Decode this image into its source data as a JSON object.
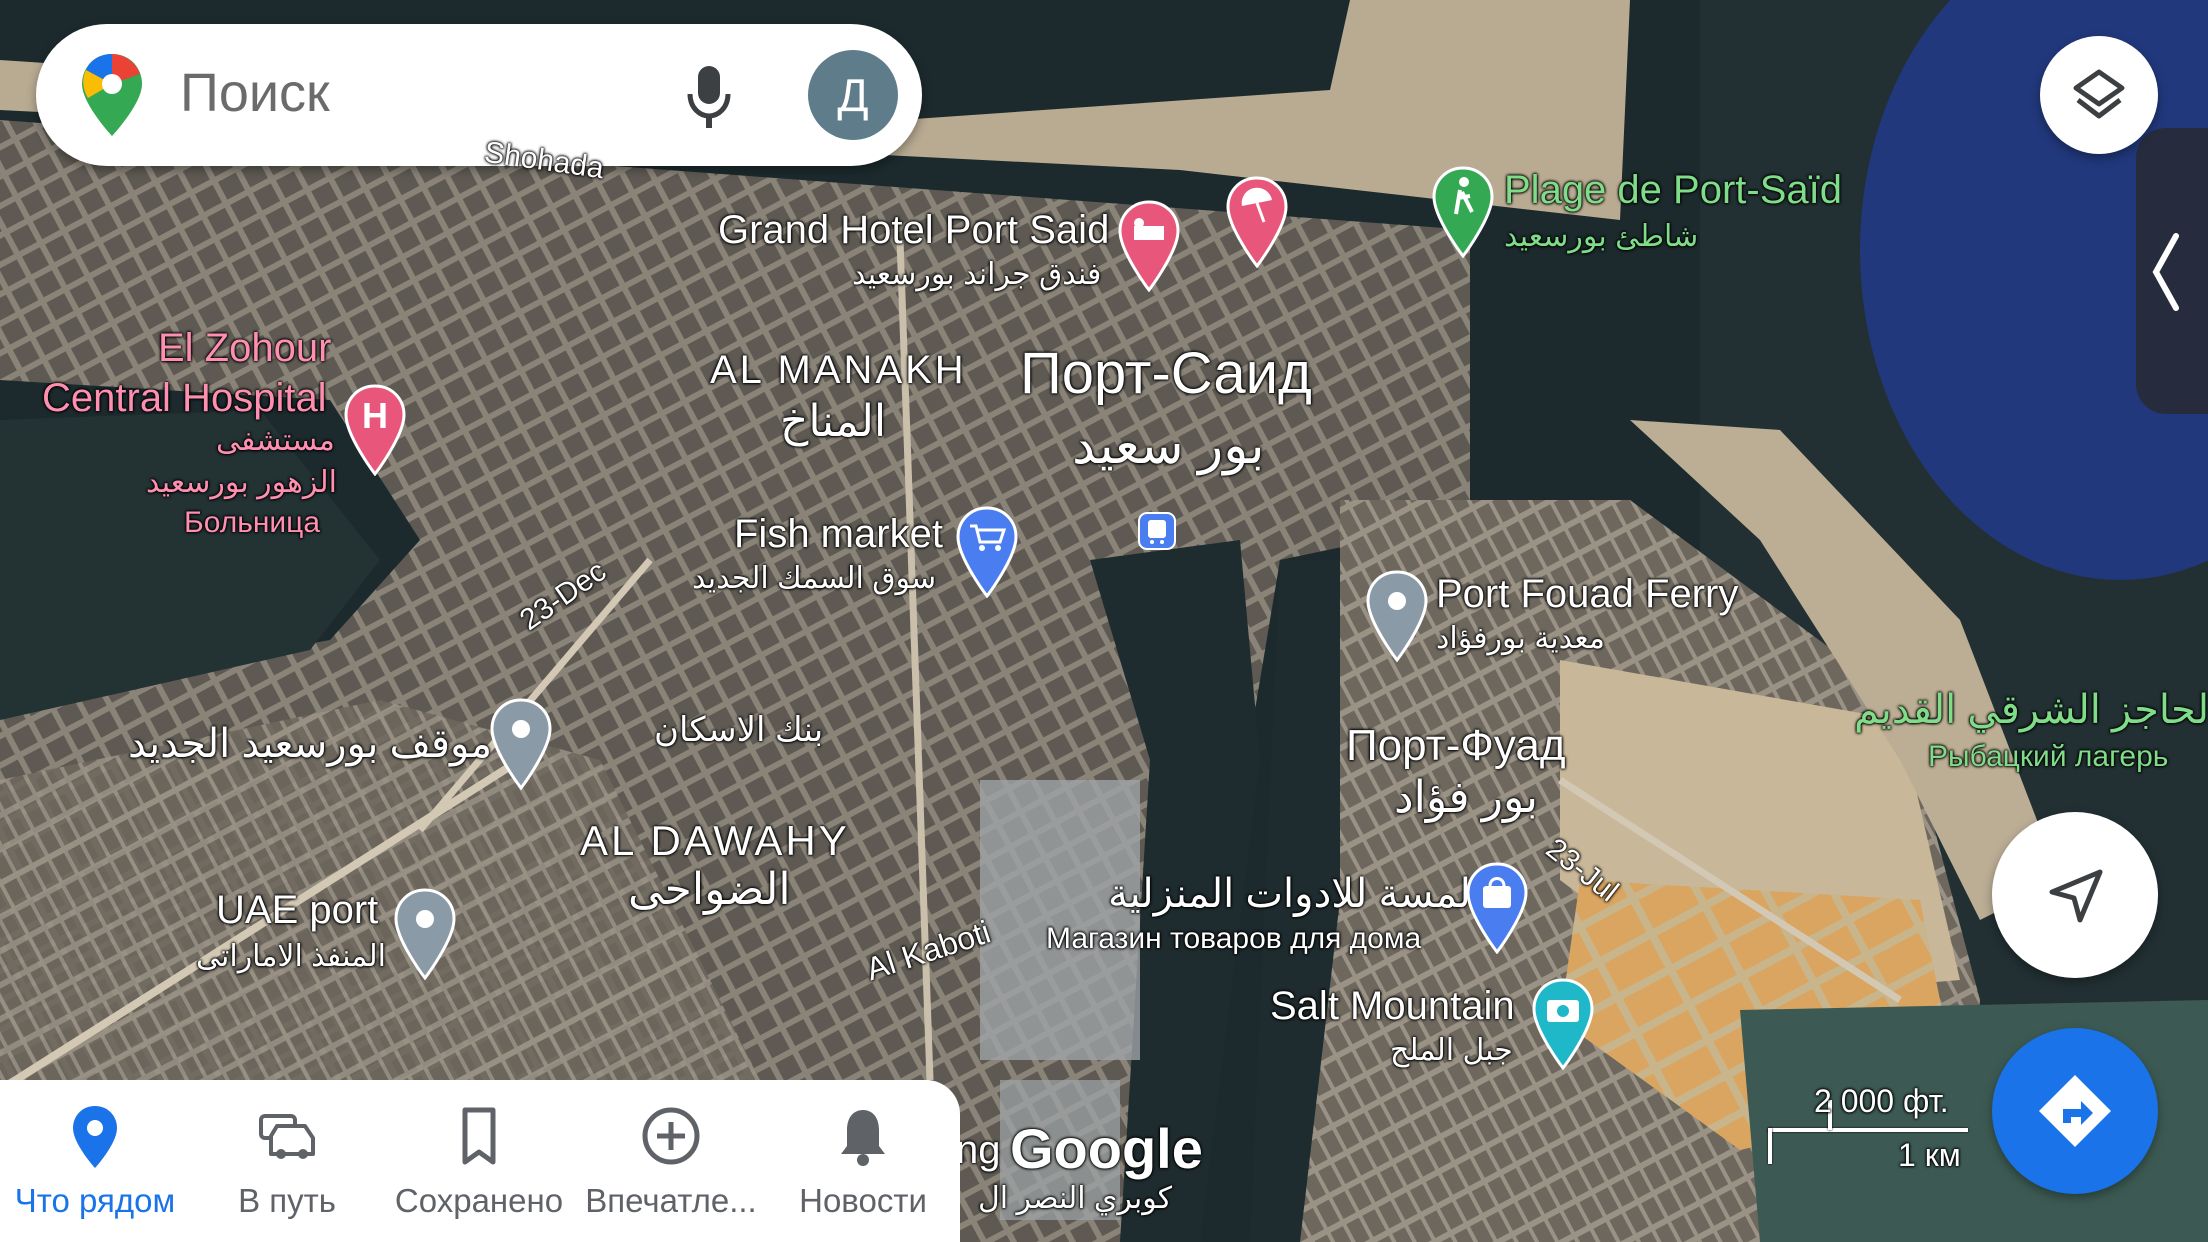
{
  "search": {
    "placeholder": "Поиск",
    "avatar_letter": "Д"
  },
  "map_labels": {
    "grand_hotel": "Grand Hotel Port Said",
    "grand_hotel_ar": "فندق جراند بورسعيد",
    "plage": "Plage de Port-Saïd",
    "plage_ar": "شاطئ بورسعيد",
    "hospital_1": "El Zohour",
    "hospital_2": "Central Hospital",
    "hospital_ar1": "مستشفى",
    "hospital_ar2": "الزهور بورسعيد",
    "hospital_ru": "Больница",
    "manakh": "AL MANAKH",
    "manakh_ar": "المناخ",
    "city": "Порт-Саид",
    "city_ar": "بور سعيد",
    "fish": "Fish market",
    "fish_ar": "سوق السمك الجديد",
    "ferry": "Port Fouad Ferry",
    "ferry_ar": "معدية بورفؤاد",
    "road_23dec": "23-Dec",
    "stop_ar": "موقف بورسعيد الجديد",
    "bank_ar": "بنك الاسكان",
    "fouad": "Порт-Фуад",
    "fouad_ar": "بور فؤاد",
    "hajez_ar": "الحاجز الشرقي القديم",
    "fishing_camp": "Рыбацкий лагерь",
    "dawahy": "AL DAWAHY",
    "dawahy_ar": "الضواحى",
    "shop_ar": "لمسة للادوات المنزلية",
    "shop_ru": "Магазин товаров для дома",
    "uae": "UAE port",
    "uae_ar": "المنفذ الاماراتى",
    "kaboti": "Al Kaboti",
    "road_23jul": "23-Jul",
    "salt": "Salt Mountain",
    "salt_ar": "جبل الملح",
    "shohada": "Shohada",
    "bridge_partial": "ng",
    "bridge_ar": "كوبري النصر ال",
    "google": "Google",
    "scale_ft": "2 000 фт.",
    "scale_km": "1 км"
  },
  "bottom_nav": {
    "items": [
      {
        "label": "Что рядом",
        "icon": "location-pin-icon",
        "active": true
      },
      {
        "label": "В путь",
        "icon": "car-icon",
        "active": false
      },
      {
        "label": "Сохранено",
        "icon": "bookmark-icon",
        "active": false
      },
      {
        "label": "Впечатле...",
        "icon": "add-circle-icon",
        "active": false
      },
      {
        "label": "Новости",
        "icon": "bell-icon",
        "active": false
      }
    ]
  },
  "colors": {
    "accent": "#1a73e8",
    "hotel_pin": "#e8577b",
    "shop_pin": "#4a7ef0",
    "gray_pin": "#8a9aa6",
    "park_pin": "#34a853",
    "photo_pin": "#1fb8c9"
  }
}
